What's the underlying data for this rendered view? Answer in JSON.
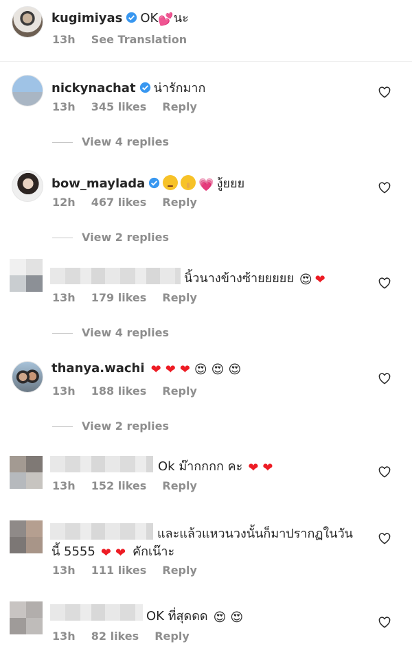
{
  "top_comment": {
    "username": "kugimiyas",
    "text_before": "OK",
    "emoji": "💕",
    "text_after": "นะ",
    "time": "13h",
    "translate": "See Translation"
  },
  "comments": [
    {
      "username": "nickynachat",
      "text": "น่ารักมาก",
      "time": "13h",
      "likes": "345 likes",
      "reply": "Reply",
      "view_replies": "View 4 replies"
    },
    {
      "username": "bow_maylada",
      "text": "งู้ยยย",
      "time": "12h",
      "likes": "467 likes",
      "reply": "Reply",
      "view_replies": "View 2 replies"
    },
    {
      "username": "",
      "text": "นิ้วนางข้างซ้ายยยยย",
      "time": "13h",
      "likes": "179 likes",
      "reply": "Reply",
      "view_replies": "View 4 replies"
    },
    {
      "username": "thanya.wachi",
      "text": "",
      "time": "13h",
      "likes": "188 likes",
      "reply": "Reply",
      "view_replies": "View 2 replies"
    },
    {
      "username": "",
      "text": "Ok ม๊ากกกก คะ",
      "time": "13h",
      "likes": "152 likes",
      "reply": "Reply"
    },
    {
      "username": "",
      "text_line1": "และแล้วแหวนวงนั้นก็มาปรากฏในวัน",
      "text_line2_a": "นี้ 5555",
      "text_line2_b": "คักเน๊าะ",
      "time": "13h",
      "likes": "111 likes",
      "reply": "Reply"
    },
    {
      "username": "",
      "text": "OK ที่สุดดด",
      "time": "13h",
      "likes": "82 likes",
      "reply": "Reply"
    }
  ],
  "colors": {
    "verified": "#3897f0",
    "heart_red": "#ed1c24",
    "meta": "#8e8e8e",
    "text": "#262626"
  },
  "icons": {
    "like": "heart-outline-icon",
    "verified": "verified-badge-icon"
  }
}
